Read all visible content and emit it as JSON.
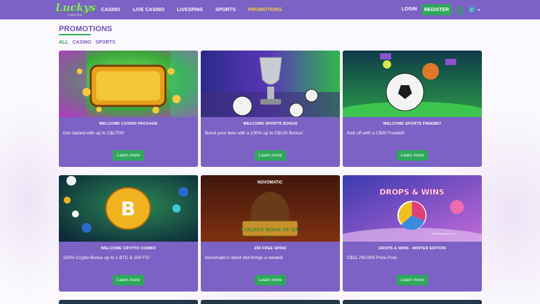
{
  "header": {
    "logo_text": "Luckys",
    "logo_sub": "casino",
    "nav": [
      "CASINO",
      "LIVE CASINO",
      "LIVESPINS",
      "SPORTS",
      "PROMOTIONS"
    ],
    "active_nav": "PROMOTIONS",
    "login_label": "LOGIN",
    "register_label": "REGISTER"
  },
  "page": {
    "title": "PROMOTIONS",
    "filters": [
      "ALL",
      "CASINO",
      "SPORTS"
    ],
    "active_filter": "ALL"
  },
  "promotions": [
    {
      "title": "WELCOME CASINO PACKAGE",
      "description": "Get started with up to C$1700!",
      "button": "Learn more",
      "image": "big-win-slot-graphic"
    },
    {
      "title": "WELCOME SPORTS BONUS",
      "description": "Boost your bets with a 100% up to C$100 Bonus!",
      "button": "Learn more",
      "image": "trophy-and-balls-graphic"
    },
    {
      "title": "WELCOME SPORTS FREEBET",
      "description": "Kick off with a C$30 Freebet!",
      "button": "Learn more",
      "image": "soccer-ball-stadium-graphic"
    },
    {
      "title": "WELCOME CRYPTO COMBO",
      "description": "150% Crypto Bonus up to 1 BTC & 150 FS!",
      "button": "Learn more",
      "image": "bitcoin-coin-graphic"
    },
    {
      "title": "250 FREE SPINS",
      "description": "Novomatic's latest slot brings a reward!",
      "button": "Learn more",
      "image": "novomatic-slot-graphic",
      "brand": "NOVOMATIC",
      "game": "GOLDEN BOOK OF RA"
    },
    {
      "title": "DROPS & WINS - WINTER EDITION",
      "description": "C$11,760,000 Prize Pool",
      "button": "Learn more",
      "image": "drops-and-wins-wheel-graphic",
      "brand": "DROPS & WINS",
      "provider": "PRAGMATIC PLAY"
    }
  ],
  "colors": {
    "header_bg": "#7b62c4",
    "card_bg": "#7b62c4",
    "accent_green": "#2ea85a",
    "active_nav": "#f4d23c"
  }
}
